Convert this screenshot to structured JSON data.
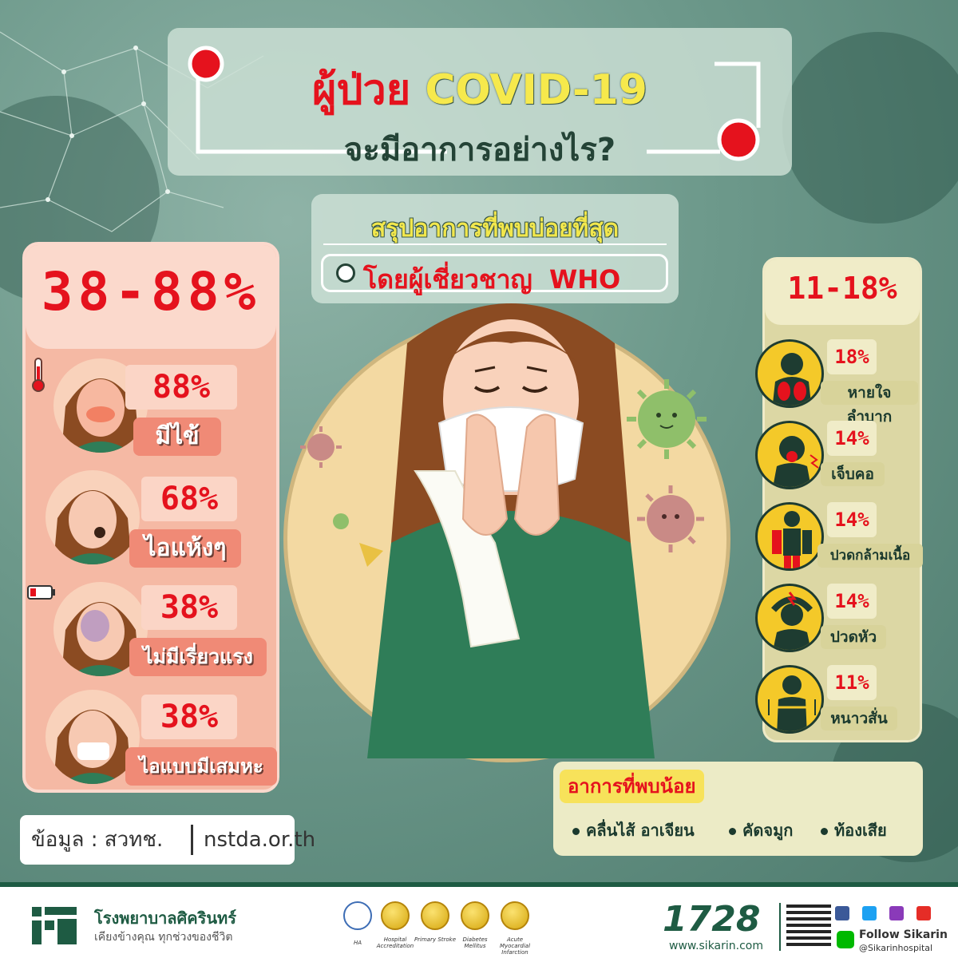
{
  "title": {
    "word_patient": "ผู้ป่วย",
    "word_covid": "COVID-19",
    "question": "จะมีอาการอย่างไร?"
  },
  "summary": {
    "title": "สรุปอาการที่พบบ่อยที่สุด",
    "by_prefix": "โดยผู้เชี่ยวชาญ",
    "by_org": "WHO"
  },
  "left_panel": {
    "range": "38-88%",
    "items": [
      {
        "pct": "88%",
        "label": "มีไข้"
      },
      {
        "pct": "68%",
        "label": "ไอแห้งๆ"
      },
      {
        "pct": "38%",
        "label": "ไม่มีเรี่ยวแรง"
      },
      {
        "pct": "38%",
        "label": "ไอแบบมีเสมหะ"
      }
    ]
  },
  "right_panel": {
    "range": "11-18%",
    "items": [
      {
        "pct": "18%",
        "label": "หายใจลำบาก"
      },
      {
        "pct": "14%",
        "label": "เจ็บคอ"
      },
      {
        "pct": "14%",
        "label": "ปวดกล้ามเนื้อ"
      },
      {
        "pct": "14%",
        "label": "ปวดหัว"
      },
      {
        "pct": "11%",
        "label": "หนาวสั่น"
      }
    ]
  },
  "less_common": {
    "title": "อาการที่พบน้อย",
    "items": [
      "คลื่นไส้ อาเจียน",
      "คัดจมูก",
      "ท้องเสีย"
    ]
  },
  "source": {
    "label": "ข้อมูล : สวทช.",
    "site": "nstda.or.th"
  },
  "footer": {
    "hospital": "โรงพยาบาลศิครินทร์",
    "tagline": "เคียงข้างคุณ ทุกช่วงของชีวิต",
    "badges": [
      {
        "label": "HA"
      },
      {
        "label": "Hospital Accreditation"
      },
      {
        "label": "Primary Stroke"
      },
      {
        "label": "Diabetes Mellitus"
      },
      {
        "label": "Acute Myocardial Infarction"
      }
    ],
    "hotline": "1728",
    "website": "www.sikarin.com",
    "follow": "Follow Sikarin",
    "handle": "@Sikarinhospital"
  },
  "colors": {
    "accent_red": "#e5121d",
    "accent_yellow": "#f6e94c",
    "brand_green": "#1e5b43"
  }
}
